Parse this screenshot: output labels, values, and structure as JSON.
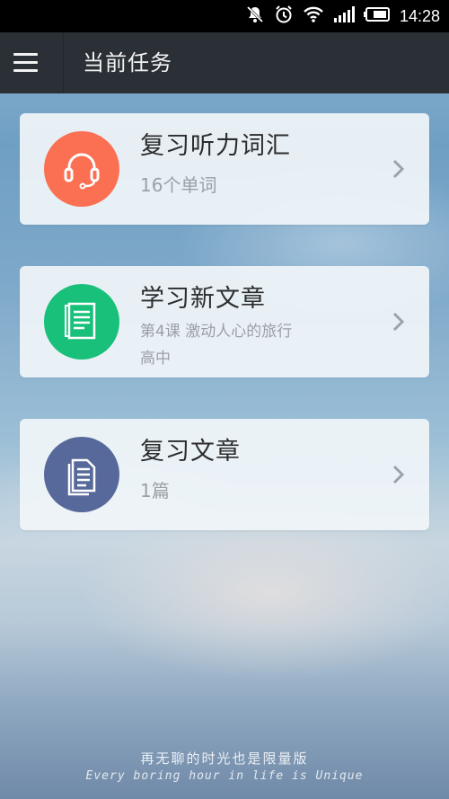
{
  "status_bar": {
    "time": "14:28",
    "icons": [
      "mute-icon",
      "alarm-icon",
      "wifi-icon",
      "signal-icon",
      "battery-icon"
    ]
  },
  "app_bar": {
    "menu_icon": "menu-icon",
    "title": "当前任务"
  },
  "tasks": [
    {
      "title": "复习听力词汇",
      "subtitle": "16个单词",
      "icon": "headset-icon",
      "color": "#fb6f52"
    },
    {
      "title": "学习新文章",
      "subtitle": "第4课 激动人心的旅行",
      "subtitle2": "高中",
      "icon": "document-icon",
      "color": "#19c07a"
    },
    {
      "title": "复习文章",
      "subtitle": "1篇",
      "icon": "documents-icon",
      "color": "#57699a"
    }
  ],
  "wallpaper": {
    "line1": "再无聊的时光也是限量版",
    "line2": "Every boring hour in life is Unique"
  }
}
